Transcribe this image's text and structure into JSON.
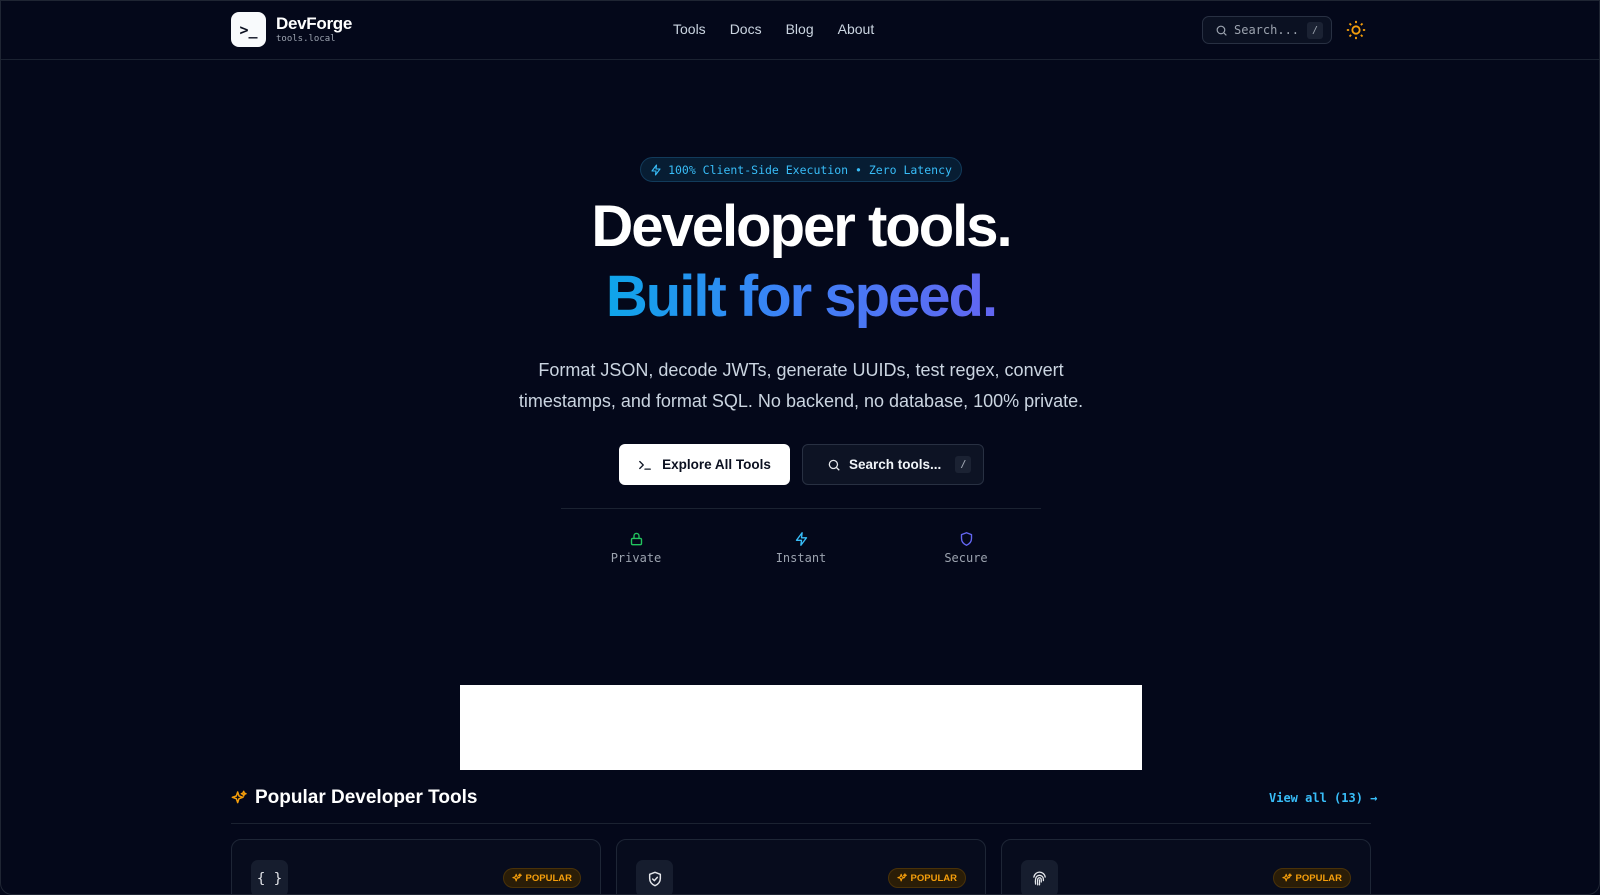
{
  "header": {
    "logo_glyph": ">_",
    "brand": "DevForge",
    "domain": "tools.local",
    "nav": [
      "Tools",
      "Docs",
      "Blog",
      "About"
    ],
    "search_placeholder": "Search...",
    "search_shortcut": "/",
    "theme_icon": "sun-icon"
  },
  "hero": {
    "badge": "100% Client-Side Execution • Zero Latency",
    "title_line1": "Developer tools.",
    "title_line2": "Built for speed.",
    "subtitle_line1": "Format JSON, decode JWTs, generate UUIDs, test regex, convert",
    "subtitle_line2": "timestamps, and format SQL. No backend, no database, 100% private.",
    "explore_label": "Explore All Tools",
    "search_label": "Search tools...",
    "search_shortcut": "/",
    "features": [
      {
        "label": "Private",
        "icon": "lock-icon",
        "color": "#22c55e"
      },
      {
        "label": "Instant",
        "icon": "zap-icon",
        "color": "#38bdf8"
      },
      {
        "label": "Secure",
        "icon": "shield-icon",
        "color": "#6366f1"
      }
    ]
  },
  "popular": {
    "title": "Popular Developer Tools",
    "view_all": "View all (13) →",
    "cards": [
      {
        "icon": "braces-icon",
        "icon_glyph": "{ }",
        "tag": "POPULAR"
      },
      {
        "icon": "shield-check-icon",
        "icon_glyph": "",
        "tag": "POPULAR"
      },
      {
        "icon": "fingerprint-icon",
        "icon_glyph": "",
        "tag": "POPULAR"
      }
    ]
  },
  "colors": {
    "background": "#04081a",
    "accent": "#38bdf8",
    "gradient_start": "#0ea5e9",
    "gradient_end": "#6366f1",
    "popular_tag": "#f59e0b"
  }
}
